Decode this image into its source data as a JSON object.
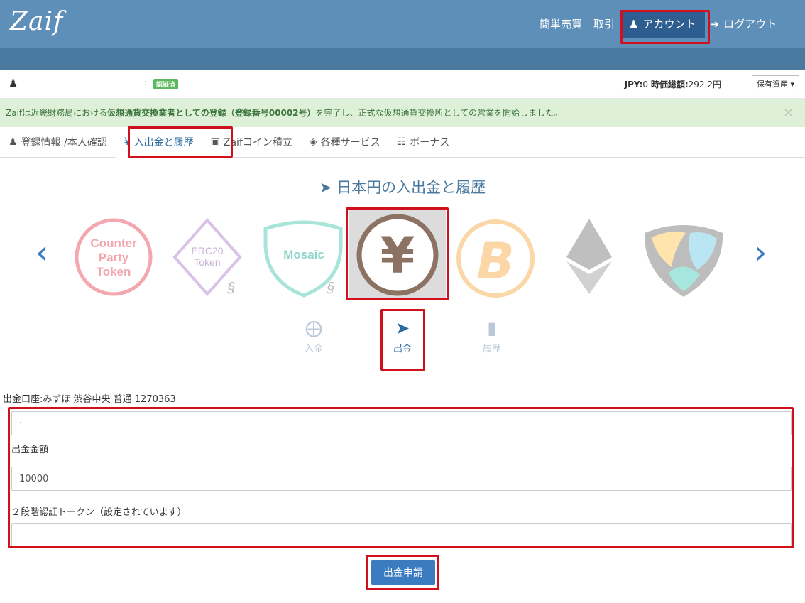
{
  "header": {
    "logo": "Zaif",
    "nav": [
      "簡単売買",
      "取引",
      "アカウント",
      "ログアウト"
    ]
  },
  "userbar": {
    "colon": ":",
    "badge": "認証済",
    "jpy_label": "JPY:",
    "jpy_value": "0",
    "valuation_label": "時価総額:",
    "valuation_value": "292.2円",
    "asset_button": "保有資産 ▾"
  },
  "notice": {
    "prefix": "Zaifは近畿財務局における",
    "bold": "仮想通貨交換業者としての登録（登録番号00002号）",
    "suffix": "を完了し、正式な仮想通貨交換所としての営業を開始しました。",
    "close": "×"
  },
  "tabs": [
    "登録情報 /本人確認",
    "入出金と履歴",
    "Zaifコイン積立",
    "各種サービス",
    "ボーナス"
  ],
  "main": {
    "heading": "日本円の入出金と履歴",
    "actions": [
      "入金",
      "出金",
      "履歴"
    ]
  },
  "coins": {
    "counterparty": [
      "Counter",
      "Party",
      "Token"
    ],
    "erc20": [
      "ERC20",
      "Token"
    ],
    "mosaic": "Mosaic",
    "yen": "¥",
    "btc": "B"
  },
  "form": {
    "account_label": "出金口座:みずほ 渋谷中央 普通 1270363",
    "first_value": "·",
    "amount_label": "出金金額",
    "amount_value": "10000",
    "token_label": "２段階認証トークン（設定されています）",
    "token_value": "",
    "submit": "出金申請"
  },
  "colors": {
    "header": "#5e8fb8",
    "accent": "#3b7bbf",
    "highlight": "#d0101c"
  }
}
